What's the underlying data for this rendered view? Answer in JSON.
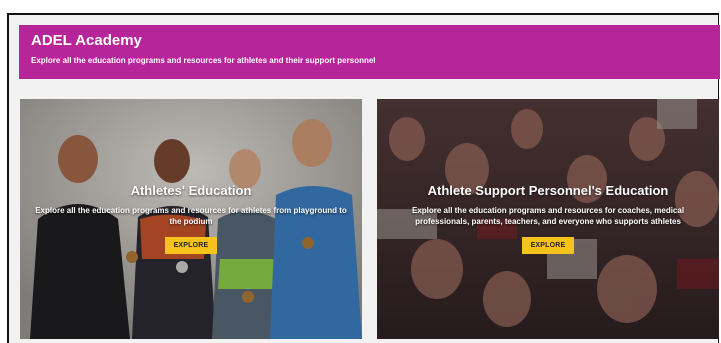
{
  "banner": {
    "title": "ADEL Academy",
    "subtitle": "Explore all the education programs and resources for athletes and their support personnel"
  },
  "cards": [
    {
      "title": "Athletes' Education",
      "description": "Explore all the education programs and resources for athletes from playground to the podium",
      "button_label": "EXPLORE"
    },
    {
      "title": "Athlete Support Personnel's Education",
      "description": "Explore all the education programs and resources for coaches, medical professionals, parents, teachers, and everyone who supports athletes",
      "button_label": "EXPLORE"
    }
  ],
  "colors": {
    "banner_bg": "#b8259a",
    "button_bg": "#f6c31a"
  }
}
